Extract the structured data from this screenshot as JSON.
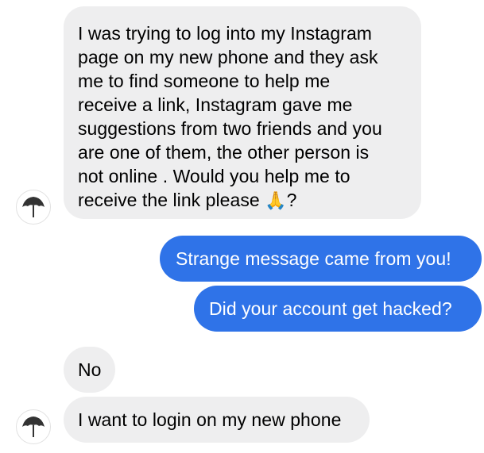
{
  "messages": [
    {
      "direction": "incoming",
      "text": "I was trying to log into my Instagram\npage on my new phone and they ask\nme to find someone to help me\nreceive a link, Instagram gave me\nsuggestions from two friends and you\nare one of them, the other person is\nnot online .  Would you help me to\nreceive the link please",
      "emoji": "🙏",
      "suffix": "?"
    },
    {
      "direction": "outgoing",
      "text": "Strange message came from you!"
    },
    {
      "direction": "outgoing",
      "text": "Did your account get hacked?"
    },
    {
      "direction": "incoming",
      "text": "No"
    },
    {
      "direction": "incoming",
      "text": "I want to login on my new phone"
    }
  ],
  "contact": {
    "avatar_icon": "umbrella-icon"
  },
  "colors": {
    "incoming_bubble": "#eeeeef",
    "outgoing_bubble": "#2f73e8",
    "outgoing_text": "#ffffff"
  }
}
